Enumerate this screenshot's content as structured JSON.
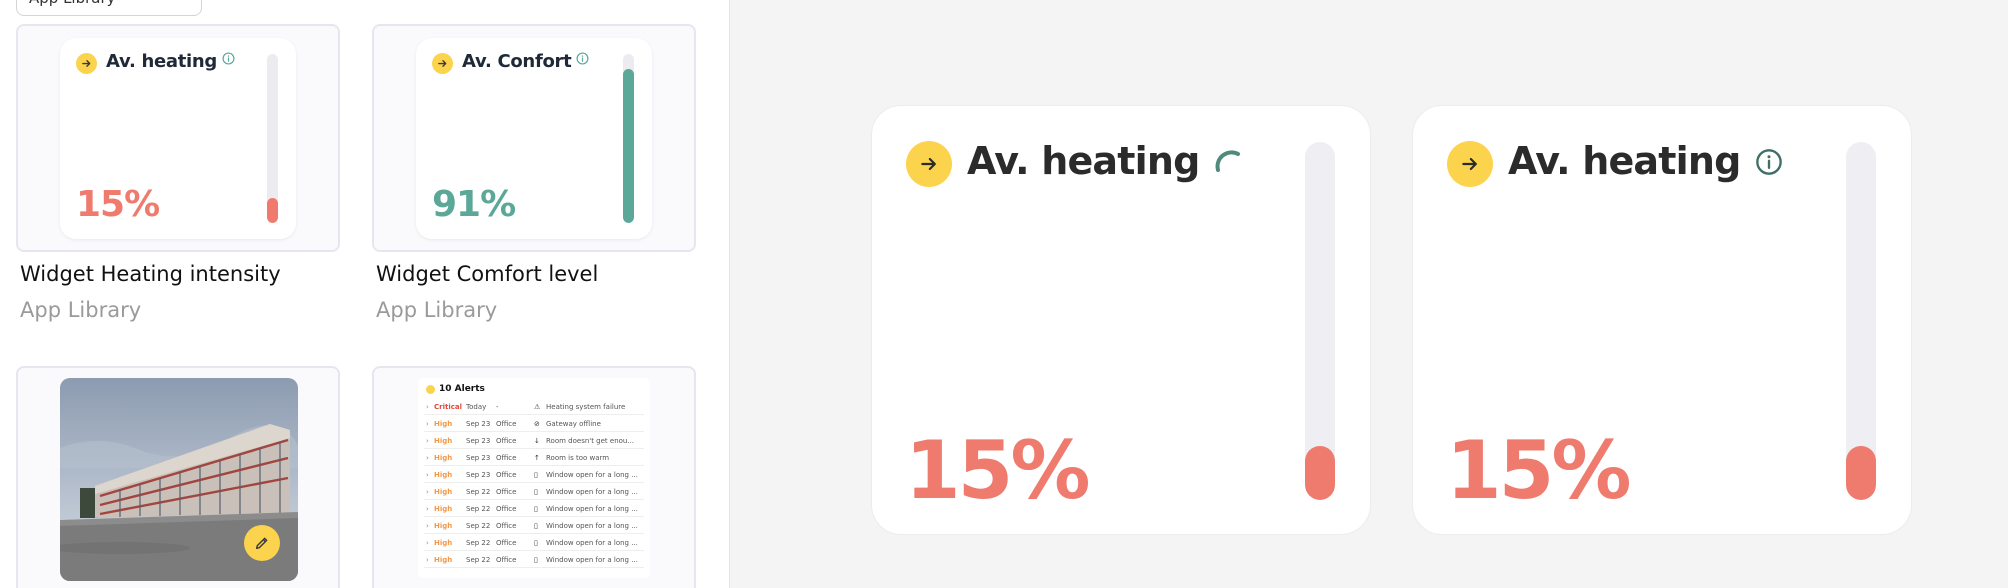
{
  "library": {
    "top_button_label": "App Library",
    "cards": [
      {
        "title": "Widget Heating intensity",
        "subtitle": "App Library",
        "widget_title": "Av. heating",
        "value_text": "15%",
        "level": 0.15,
        "color": "#ef7b6f"
      },
      {
        "title": "Widget Comfort level",
        "subtitle": "App Library",
        "widget_title": "Av. Confort",
        "value_text": "91%",
        "level": 0.91,
        "color": "#5ba898"
      }
    ],
    "alerts": {
      "title": "10 Alerts",
      "rows": [
        {
          "severity": "Critical",
          "date": "Today",
          "room": "-",
          "icon": "warning-icon",
          "message": "Heating system failure"
        },
        {
          "severity": "High",
          "date": "Sep 23",
          "room": "Office",
          "icon": "wifi-off-icon",
          "message": "Gateway offline"
        },
        {
          "severity": "High",
          "date": "Sep 23",
          "room": "Office",
          "icon": "temperature-down-icon",
          "message": "Room doesn't get enou..."
        },
        {
          "severity": "High",
          "date": "Sep 23",
          "room": "Office",
          "icon": "temperature-up-icon",
          "message": "Room is too warm"
        },
        {
          "severity": "High",
          "date": "Sep 23",
          "room": "Office",
          "icon": "window-icon",
          "message": "Window open for a long ..."
        },
        {
          "severity": "High",
          "date": "Sep 22",
          "room": "Office",
          "icon": "window-icon",
          "message": "Window open for a long ..."
        },
        {
          "severity": "High",
          "date": "Sep 22",
          "room": "Office",
          "icon": "window-icon",
          "message": "Window open for a long ..."
        },
        {
          "severity": "High",
          "date": "Sep 22",
          "room": "Office",
          "icon": "window-icon",
          "message": "Window open for a long ..."
        },
        {
          "severity": "High",
          "date": "Sep 22",
          "room": "Office",
          "icon": "window-icon",
          "message": "Window open for a long ..."
        },
        {
          "severity": "High",
          "date": "Sep 22",
          "room": "Office",
          "icon": "window-icon",
          "message": "Window open for a long ..."
        }
      ]
    }
  },
  "widgets": [
    {
      "title": "Av. heating",
      "value_text": "15%",
      "level": 0.15,
      "indicator": "loading-spinner-icon",
      "color": "#ef7b6f"
    },
    {
      "title": "Av. heating",
      "value_text": "15%",
      "level": 0.15,
      "indicator": "info-icon",
      "color": "#ef7b6f"
    }
  ],
  "colors": {
    "accent_yellow": "#fcd34d",
    "heating_red": "#ef7b6f",
    "comfort_green": "#5ba898",
    "critical": "#e04b3c",
    "high": "#f2994a"
  }
}
